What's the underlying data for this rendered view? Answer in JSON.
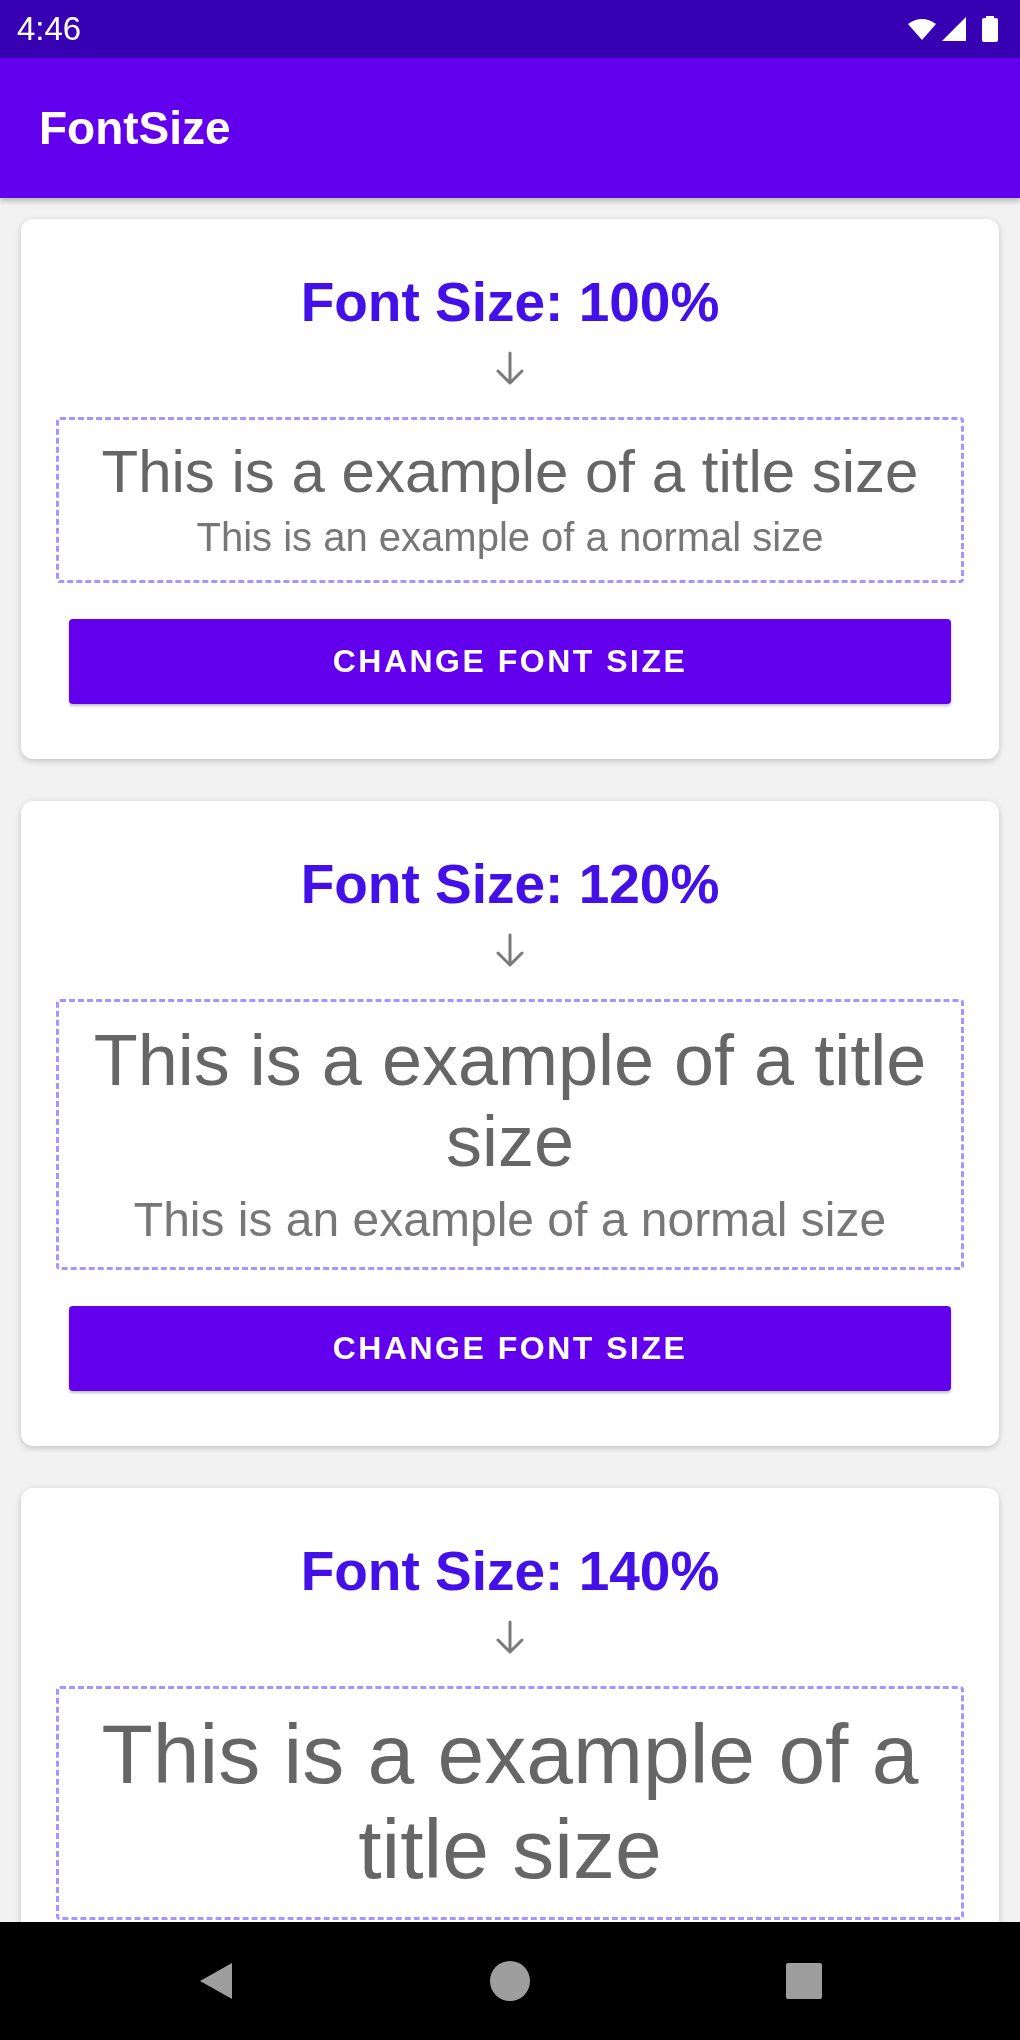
{
  "status_bar": {
    "time": "4:46"
  },
  "app_bar": {
    "title": "FontSize"
  },
  "cards": [
    {
      "heading": "Font Size: 100%",
      "kind": "default",
      "title_sample": "This is a example of a title size",
      "normal_sample": "This is an example of a normal size",
      "button": "CHANGE FONT SIZE"
    },
    {
      "heading": "Font Size: 120%",
      "kind": "large",
      "title_sample": "This is a example of a title size",
      "normal_sample": "This is an example of a normal size",
      "button": "CHANGE FONT SIZE"
    },
    {
      "heading": "Font Size: 140%",
      "kind": "larger",
      "title_sample": "This is a example of a title size"
    }
  ]
}
